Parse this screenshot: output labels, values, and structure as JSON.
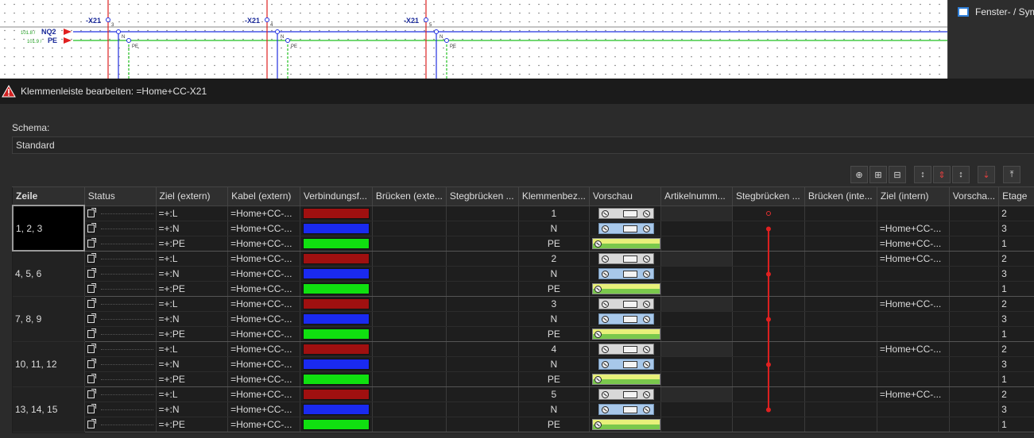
{
  "schematic": {
    "labels": [
      "-X21",
      "-X21",
      "-X21"
    ],
    "pin_numbers": [
      "3",
      "4",
      "5"
    ],
    "n_label": "N",
    "pe_label": "PE",
    "nq2": {
      "ref": "101.8 /",
      "name": "NQ2"
    },
    "pe_line": {
      "ref": "101.9 /",
      "name": "PE"
    }
  },
  "right_panel": {
    "tab_label": "Fenster- / Sym"
  },
  "dialog": {
    "title": "Klemmenleiste bearbeiten: =Home+CC-X21",
    "schema_label": "Schema:",
    "schema_value": "Standard"
  },
  "toolbar": [
    "insert-row-icon",
    "insert-copy-icon",
    "insert-below-icon",
    "move-icon",
    "delete-move-icon",
    "move2-icon",
    "delete-icon",
    "move-top-icon"
  ],
  "columns": [
    "Zeile",
    "Status",
    "Ziel (extern)",
    "Kabel (extern)",
    "Verbindungsf...",
    "Brücken (exte...",
    "Stegbrücken ...",
    "Klemmenbez...",
    "Vorschau",
    "Artikelnumm...",
    "Stegbrücken ...",
    "Brücken (inte...",
    "Ziel (intern)",
    "Vorscha...",
    "Etage"
  ],
  "colors": {
    "red": "#a01010",
    "blue": "#1a2af0",
    "green": "#10e010",
    "jumper": "#e02020"
  },
  "groups": [
    {
      "zeile": "1, 2, 3",
      "selected": true,
      "rows": [
        {
          "ziel": "=+:L",
          "kabel": "=Home+CC-...",
          "color": "red",
          "klemme": "1",
          "preview": "gray",
          "intern": "",
          "etage": "2"
        },
        {
          "ziel": "=+:N",
          "kabel": "=Home+CC-...",
          "color": "blue",
          "klemme": "N",
          "preview": "blue",
          "intern": "=Home+CC-...",
          "etage": "3"
        },
        {
          "ziel": "=+:PE",
          "kabel": "=Home+CC-...",
          "color": "green",
          "klemme": "PE",
          "preview": "yellow",
          "intern": "=Home+CC-...",
          "etage": "1"
        }
      ]
    },
    {
      "zeile": "4, 5, 6",
      "selected": false,
      "rows": [
        {
          "ziel": "=+:L",
          "kabel": "=Home+CC-...",
          "color": "red",
          "klemme": "2",
          "preview": "gray",
          "intern": "=Home+CC-...",
          "etage": "2"
        },
        {
          "ziel": "=+:N",
          "kabel": "=Home+CC-...",
          "color": "blue",
          "klemme": "N",
          "preview": "blue",
          "intern": "",
          "etage": "3"
        },
        {
          "ziel": "=+:PE",
          "kabel": "=Home+CC-...",
          "color": "green",
          "klemme": "PE",
          "preview": "yellow",
          "intern": "",
          "etage": "1"
        }
      ]
    },
    {
      "zeile": "7, 8, 9",
      "selected": false,
      "rows": [
        {
          "ziel": "=+:L",
          "kabel": "=Home+CC-...",
          "color": "red",
          "klemme": "3",
          "preview": "gray",
          "intern": "=Home+CC-...",
          "etage": "2"
        },
        {
          "ziel": "=+:N",
          "kabel": "=Home+CC-...",
          "color": "blue",
          "klemme": "N",
          "preview": "blue",
          "intern": "",
          "etage": "3"
        },
        {
          "ziel": "=+:PE",
          "kabel": "=Home+CC-...",
          "color": "green",
          "klemme": "PE",
          "preview": "yellow",
          "intern": "",
          "etage": "1"
        }
      ]
    },
    {
      "zeile": "10, 11, 12",
      "selected": false,
      "rows": [
        {
          "ziel": "=+:L",
          "kabel": "=Home+CC-...",
          "color": "red",
          "klemme": "4",
          "preview": "gray",
          "intern": "=Home+CC-...",
          "etage": "2"
        },
        {
          "ziel": "=+:N",
          "kabel": "=Home+CC-...",
          "color": "blue",
          "klemme": "N",
          "preview": "blue",
          "intern": "",
          "etage": "3"
        },
        {
          "ziel": "=+:PE",
          "kabel": "=Home+CC-...",
          "color": "green",
          "klemme": "PE",
          "preview": "yellow",
          "intern": "",
          "etage": "1"
        }
      ]
    },
    {
      "zeile": "13, 14, 15",
      "selected": false,
      "rows": [
        {
          "ziel": "=+:L",
          "kabel": "=Home+CC-...",
          "color": "red",
          "klemme": "5",
          "preview": "gray",
          "intern": "=Home+CC-...",
          "etage": "2"
        },
        {
          "ziel": "=+:N",
          "kabel": "=Home+CC-...",
          "color": "blue",
          "klemme": "N",
          "preview": "blue",
          "intern": "",
          "etage": "3"
        },
        {
          "ziel": "=+:PE",
          "kabel": "=Home+CC-...",
          "color": "green",
          "klemme": "PE",
          "preview": "yellow",
          "intern": "",
          "etage": "1"
        }
      ]
    }
  ]
}
